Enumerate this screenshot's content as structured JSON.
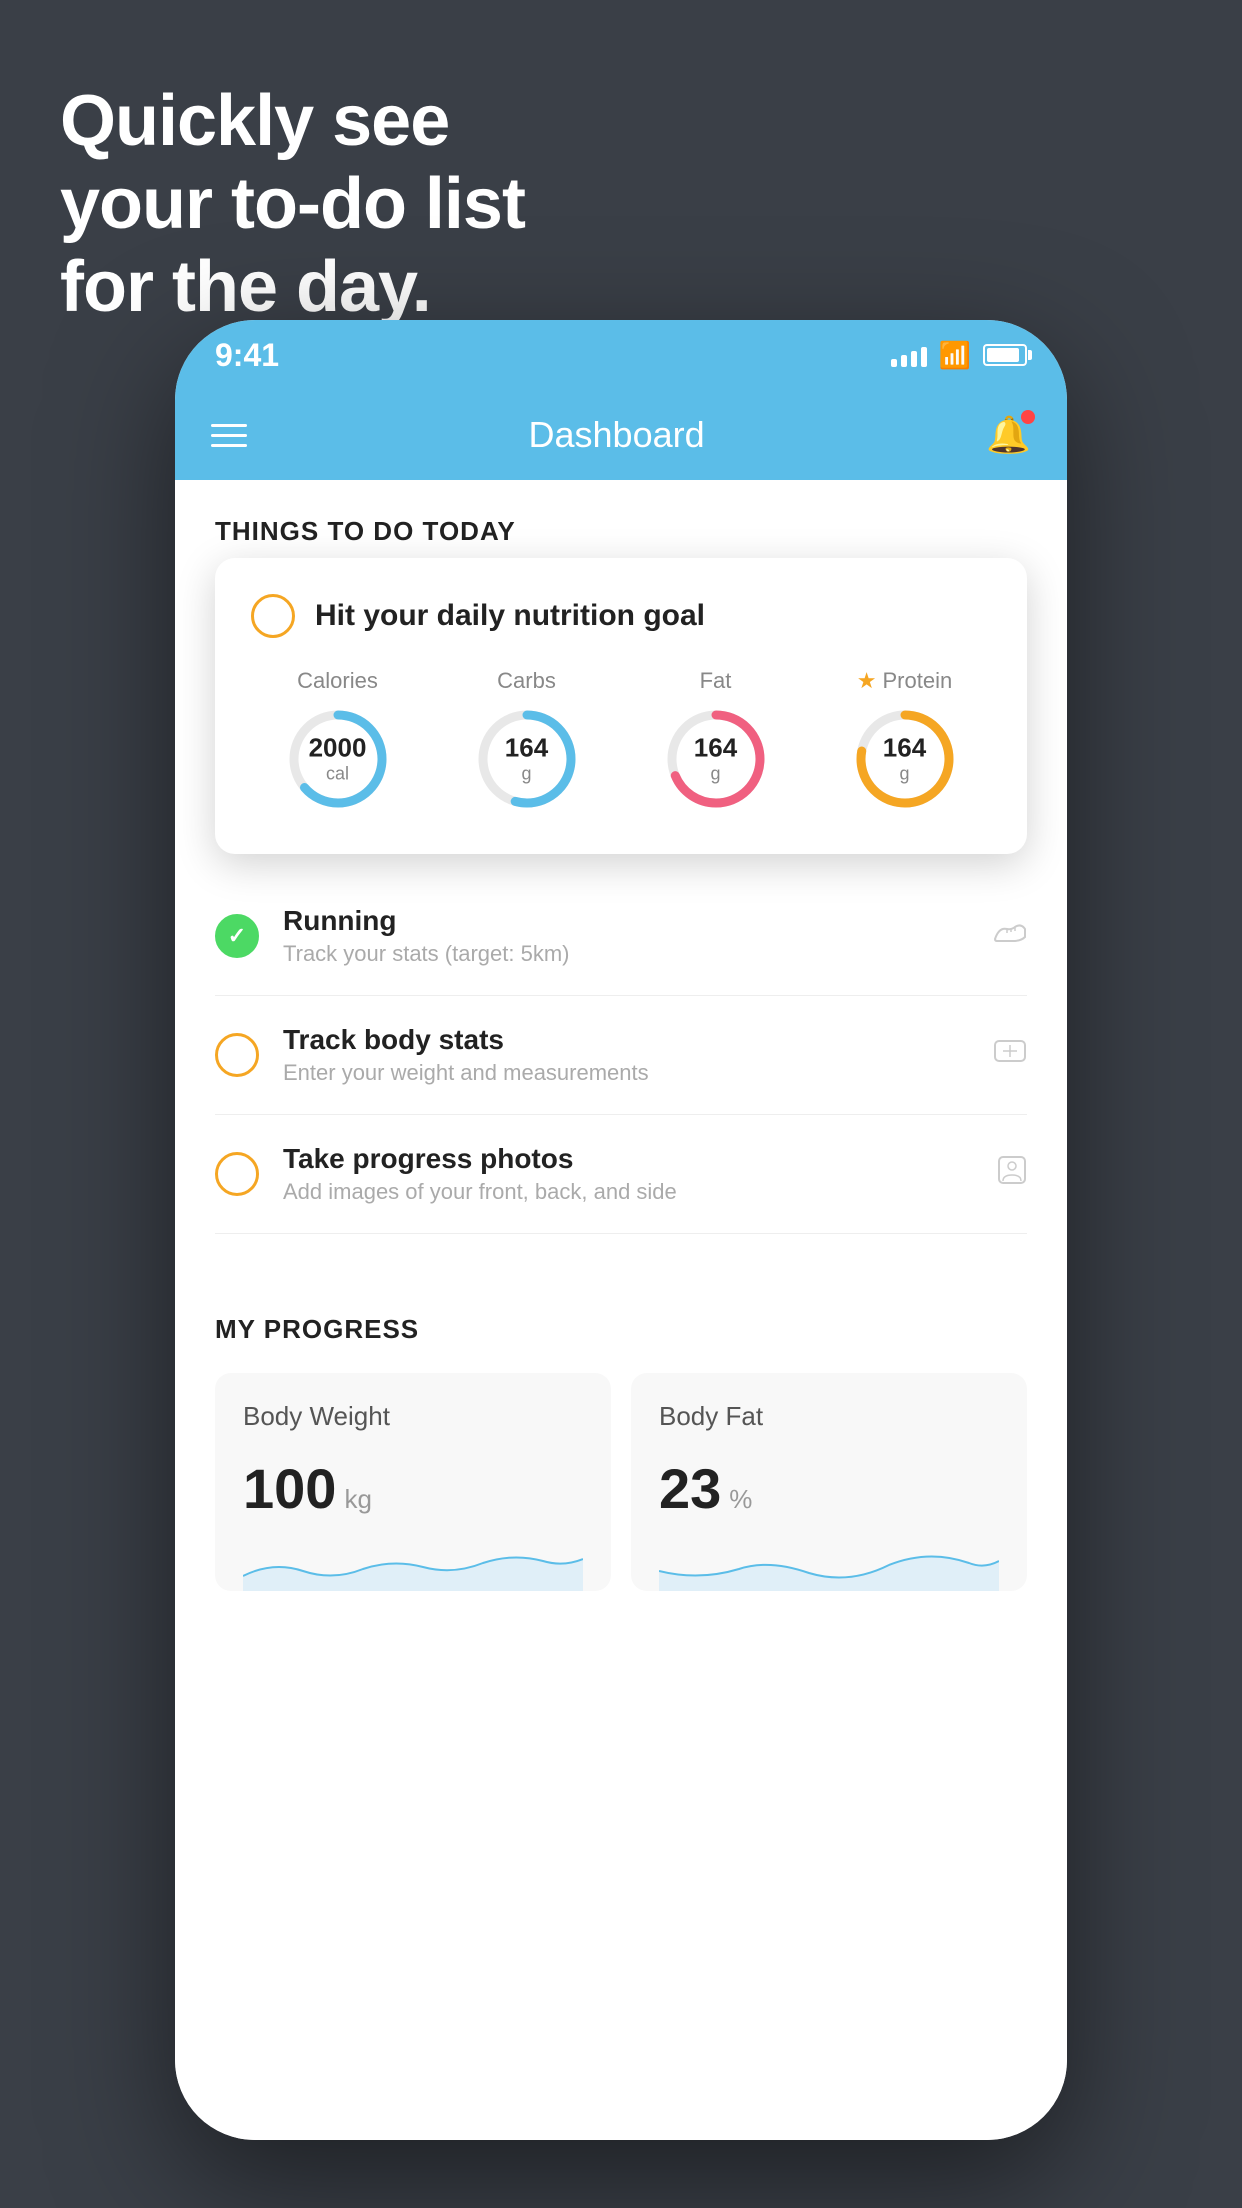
{
  "headline": {
    "line1": "Quickly see",
    "line2": "your to-do list",
    "line3": "for the day."
  },
  "status_bar": {
    "time": "9:41",
    "signal_bars": [
      8,
      12,
      16,
      20
    ],
    "battery_percent": 80
  },
  "nav": {
    "title": "Dashboard",
    "menu_label": "Menu",
    "notification_label": "Notifications"
  },
  "section_today": {
    "header": "THINGS TO DO TODAY"
  },
  "featured_card": {
    "title": "Hit your daily nutrition goal",
    "goals": [
      {
        "label": "Calories",
        "value": "2000",
        "unit": "cal",
        "color": "#5bbde8",
        "starred": false,
        "pct": 65
      },
      {
        "label": "Carbs",
        "value": "164",
        "unit": "g",
        "color": "#5bbde8",
        "starred": false,
        "pct": 55
      },
      {
        "label": "Fat",
        "value": "164",
        "unit": "g",
        "color": "#f06080",
        "starred": false,
        "pct": 70
      },
      {
        "label": "Protein",
        "value": "164",
        "unit": "g",
        "color": "#f5a623",
        "starred": true,
        "pct": 80
      }
    ]
  },
  "todo_items": [
    {
      "title": "Running",
      "subtitle": "Track your stats (target: 5km)",
      "circle_style": "green",
      "icon": "👟"
    },
    {
      "title": "Track body stats",
      "subtitle": "Enter your weight and measurements",
      "circle_style": "yellow",
      "icon": "⚖"
    },
    {
      "title": "Take progress photos",
      "subtitle": "Add images of your front, back, and side",
      "circle_style": "yellow",
      "icon": "🖼"
    }
  ],
  "progress_section": {
    "header": "MY PROGRESS",
    "cards": [
      {
        "title": "Body Weight",
        "value": "100",
        "unit": "kg"
      },
      {
        "title": "Body Fat",
        "value": "23",
        "unit": "%"
      }
    ]
  }
}
